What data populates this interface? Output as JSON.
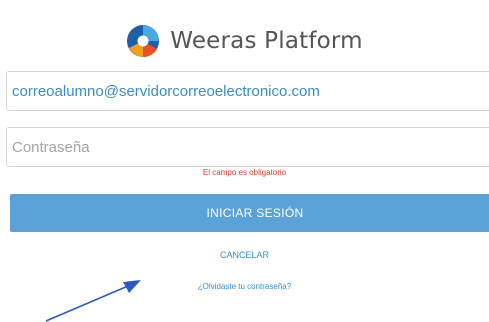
{
  "brand": {
    "title": "Weeras Platform",
    "logo_icon": "weeras-logo-icon",
    "logo_colors": [
      "#1f5fa8",
      "#4ca8e0",
      "#f0a020",
      "#e8502a"
    ]
  },
  "form": {
    "email": {
      "value": "correoalumno@servidorcorreoelectronico.com",
      "placeholder": ""
    },
    "password": {
      "value": "",
      "placeholder": "Contraseña"
    },
    "error_message": "El campo es obligatorio",
    "submit_label": "INICIAR SESIÓN",
    "cancel_label": "CANCELAR",
    "forgot_label": "¿Olvidaste tu contraseña?"
  },
  "annotation": {
    "icon": "pointer-arrow-icon",
    "color": "#2d5bbd"
  },
  "colors": {
    "accent": "#3a8dc6",
    "button": "#5aa2d8",
    "error": "#d93a2b",
    "title": "#555555"
  }
}
